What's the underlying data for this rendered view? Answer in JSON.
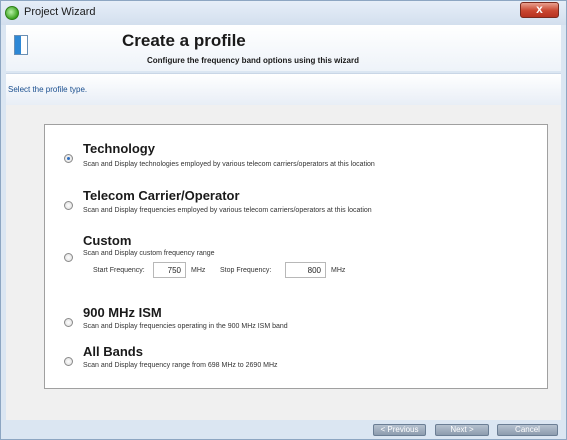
{
  "window": {
    "title": "Project Wizard",
    "close_label": "x"
  },
  "header": {
    "title": "Create a profile",
    "subtitle": "Configure the frequency band options using this wizard"
  },
  "instruction": "Select the profile type.",
  "options": [
    {
      "title": "Technology",
      "description": "Scan and Display technologies employed by various telecom carriers/operators at this location",
      "selected": true
    },
    {
      "title": "Telecom Carrier/Operator",
      "description": "Scan and Display frequencies employed by various telecom carriers/operators at this location",
      "selected": false
    },
    {
      "title": "Custom",
      "description": "Scan and Display custom frequency range",
      "selected": false
    },
    {
      "title": "900 MHz ISM",
      "description": "Scan and Display frequencies operating in the 900 MHz ISM band",
      "selected": false
    },
    {
      "title": "All Bands",
      "description": "Scan and Display frequency range from 698 MHz to 2690 MHz",
      "selected": false
    }
  ],
  "custom": {
    "start_label": "Start Frequency:",
    "start_value": "750",
    "start_unit": "MHz",
    "stop_label": "Stop Frequency:",
    "stop_value": "800",
    "stop_unit": "MHz"
  },
  "buttons": {
    "previous": "< Previous",
    "next": "Next >",
    "cancel": "Cancel"
  }
}
